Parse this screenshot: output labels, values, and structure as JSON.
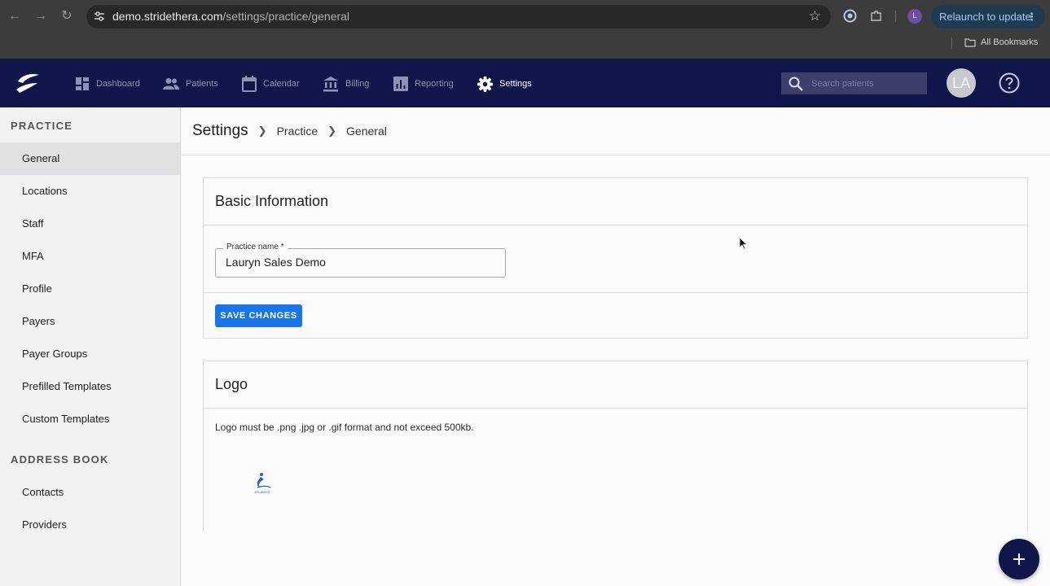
{
  "browser": {
    "url_host": "demo.stridethera.com",
    "url_path": "/settings/practice/general",
    "relaunch_label": "Relaunch to update",
    "profile_initial": "L",
    "bookmarks_label": "All Bookmarks"
  },
  "topnav": {
    "items": [
      {
        "label": "Dashboard",
        "icon": "dashboard-icon"
      },
      {
        "label": "Patients",
        "icon": "people-icon"
      },
      {
        "label": "Calendar",
        "icon": "calendar-icon"
      },
      {
        "label": "Billing",
        "icon": "bank-icon"
      },
      {
        "label": "Reporting",
        "icon": "chart-icon"
      },
      {
        "label": "Settings",
        "icon": "gear-icon",
        "active": true
      }
    ],
    "search_placeholder": "Search patients",
    "avatar_initials": "LA"
  },
  "sidebar": {
    "practice_title": "PRACTICE",
    "practice_items": [
      "General",
      "Locations",
      "Staff",
      "MFA",
      "Profile",
      "Payers",
      "Payer Groups",
      "Prefilled Templates",
      "Custom Templates"
    ],
    "address_title": "ADDRESS BOOK",
    "address_items": [
      "Contacts",
      "Providers"
    ],
    "active_item": "General"
  },
  "breadcrumb": {
    "root": "Settings",
    "level1": "Practice",
    "level2": "General"
  },
  "basic_info": {
    "title": "Basic Information",
    "practice_name_label": "Practice name *",
    "practice_name_value": "Lauryn Sales Demo",
    "save_label": "SAVE CHANGES"
  },
  "logo_card": {
    "title": "Logo",
    "note": "Logo must be .png .jpg or .gif format and not exceed 500kb.",
    "logo_text": "ATLANTIC"
  },
  "colors": {
    "nav_bg": "#10154a",
    "primary": "#1976e8"
  }
}
